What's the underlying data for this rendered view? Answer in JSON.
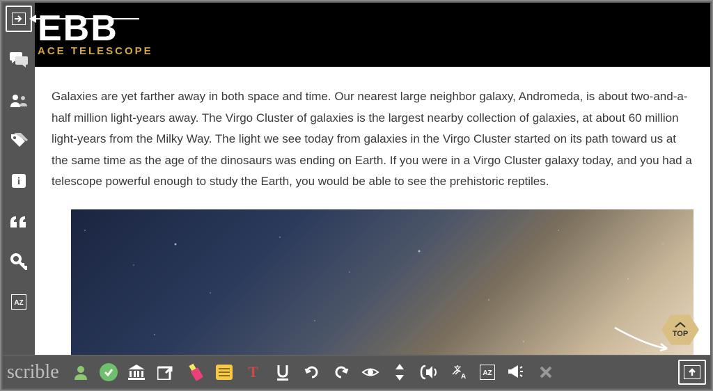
{
  "banner": {
    "title": "EBB",
    "subtitle": "ACE TELESCOPE"
  },
  "article": {
    "paragraph": "Galaxies are yet farther away in both space and time. Our nearest large neighbor galaxy, Andromeda, is about two-and-a-half million light-years away. The Virgo Cluster of galaxies is the largest nearby collection of galaxies, at about 60 million light-years from the Milky Way. The light we see today from galaxies in the Virgo Cluster started on its path toward us at the same time as the age of the dinosaurs was ending on Earth. If you were in a Virgo Cluster galaxy today, and you had a telescope powerful enough to study the Earth, you would be able to see the prehistoric reptiles."
  },
  "top_button": {
    "label": "TOP"
  },
  "sidebar": {
    "items": [
      {
        "name": "login-icon",
        "char": "➔"
      },
      {
        "name": "comments-icon",
        "char": "💬"
      },
      {
        "name": "users-icon",
        "char": "👥"
      },
      {
        "name": "tags-icon",
        "char": "🏷"
      },
      {
        "name": "info-icon",
        "char": "i"
      },
      {
        "name": "quotes-icon",
        "char": "❝"
      },
      {
        "name": "key-icon",
        "char": "🔑"
      },
      {
        "name": "az-icon",
        "char": "AZ"
      }
    ]
  },
  "toolbar": {
    "brand": "scrible",
    "tools": [
      {
        "name": "user-icon"
      },
      {
        "name": "check-icon"
      },
      {
        "name": "institution-icon"
      },
      {
        "name": "share-icon"
      },
      {
        "name": "highlighter-icon"
      },
      {
        "name": "sticky-note-icon"
      },
      {
        "name": "text-style-icon"
      },
      {
        "name": "underline-icon"
      },
      {
        "name": "undo-icon"
      },
      {
        "name": "redo-icon"
      },
      {
        "name": "visibility-icon"
      },
      {
        "name": "sort-icon"
      },
      {
        "name": "audio-icon"
      },
      {
        "name": "translate-icon"
      },
      {
        "name": "dictionary-icon"
      },
      {
        "name": "announce-icon"
      },
      {
        "name": "close-icon"
      },
      {
        "name": "upload-icon"
      }
    ]
  }
}
